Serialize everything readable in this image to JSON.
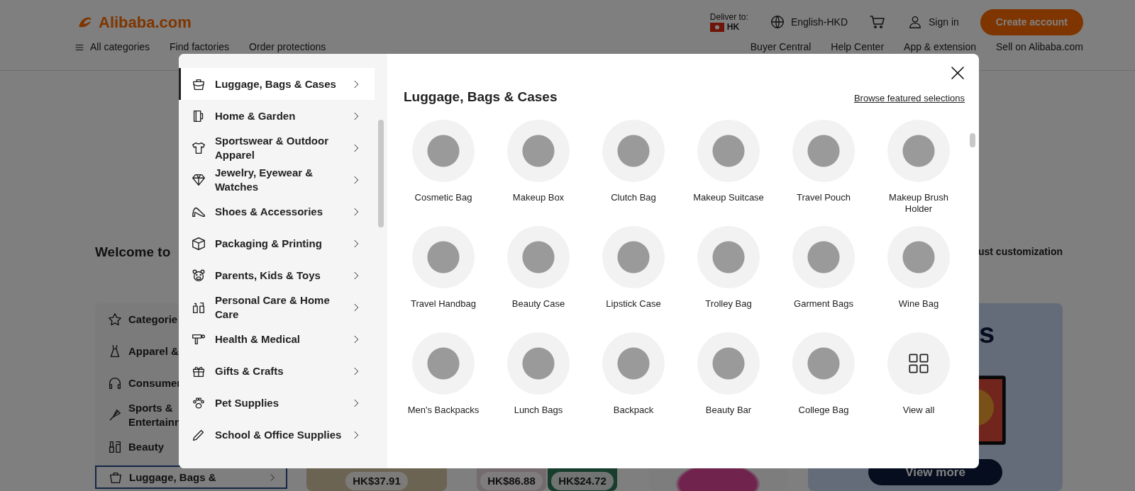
{
  "header": {
    "logo": "Alibaba.com",
    "deliver_label": "Deliver to:",
    "deliver_country": "HK",
    "language": "English-HKD",
    "sign_in": "Sign in",
    "create_account": "Create account"
  },
  "nav": {
    "left": [
      "All categories",
      "Find factories",
      "Order protections"
    ],
    "right": [
      "Buyer Central",
      "Help Center",
      "App & extension",
      "Sell on Alibaba.com"
    ]
  },
  "welcome_heading": "Welcome to",
  "customization_text": "ust customization",
  "sidebar": {
    "items": [
      {
        "label": "Categorie",
        "selected": false
      },
      {
        "label": "Apparel &",
        "selected": false
      },
      {
        "label": "Consumer",
        "selected": false
      },
      {
        "label": "Sports & Entertainn",
        "selected": false
      },
      {
        "label": "Beauty",
        "selected": false
      },
      {
        "label": "Luggage, Bags &",
        "selected": true
      }
    ]
  },
  "product_cards": [
    {
      "price": "HK$37.91"
    },
    {
      "price": "HK$86.88"
    },
    {
      "price": "HK$24.72"
    }
  ],
  "promo_banner": {
    "heading": "s",
    "button": "View more"
  },
  "category_modal": {
    "categories": [
      {
        "label": "Luggage, Bags & Cases",
        "selected": true
      },
      {
        "label": "Home & Garden",
        "selected": false
      },
      {
        "label": "Sportswear & Outdoor Apparel",
        "selected": false
      },
      {
        "label": "Jewelry, Eyewear & Watches",
        "selected": false
      },
      {
        "label": "Shoes & Accessories",
        "selected": false
      },
      {
        "label": "Packaging & Printing",
        "selected": false
      },
      {
        "label": "Parents, Kids & Toys",
        "selected": false
      },
      {
        "label": "Personal Care & Home Care",
        "selected": false
      },
      {
        "label": "Health & Medical",
        "selected": false
      },
      {
        "label": "Gifts & Crafts",
        "selected": false
      },
      {
        "label": "Pet Supplies",
        "selected": false
      },
      {
        "label": "School & Office Supplies",
        "selected": false
      }
    ],
    "title": "Luggage, Bags & Cases",
    "browse_link": "Browse featured selections",
    "products": [
      {
        "name": "Cosmetic Bag",
        "kind": "photo"
      },
      {
        "name": "Makeup Box",
        "kind": "photo"
      },
      {
        "name": "Clutch Bag",
        "kind": "photo"
      },
      {
        "name": "Makeup Suitcase",
        "kind": "photo"
      },
      {
        "name": "Travel Pouch",
        "kind": "photo"
      },
      {
        "name": "Makeup Brush Holder",
        "kind": "photo"
      },
      {
        "name": "Travel Handbag",
        "kind": "photo"
      },
      {
        "name": "Beauty Case",
        "kind": "photo"
      },
      {
        "name": "Lipstick Case",
        "kind": "photo"
      },
      {
        "name": "Trolley Bag",
        "kind": "photo"
      },
      {
        "name": "Garment Bags",
        "kind": "photo"
      },
      {
        "name": "Wine Bag",
        "kind": "photo"
      },
      {
        "name": "Men's Backpacks",
        "kind": "photo"
      },
      {
        "name": "Lunch Bags",
        "kind": "photo"
      },
      {
        "name": "Backpack",
        "kind": "photo"
      },
      {
        "name": "Beauty Bar",
        "kind": "photo"
      },
      {
        "name": "College Bag",
        "kind": "photo"
      },
      {
        "name": "View all",
        "kind": "view_all"
      }
    ]
  }
}
